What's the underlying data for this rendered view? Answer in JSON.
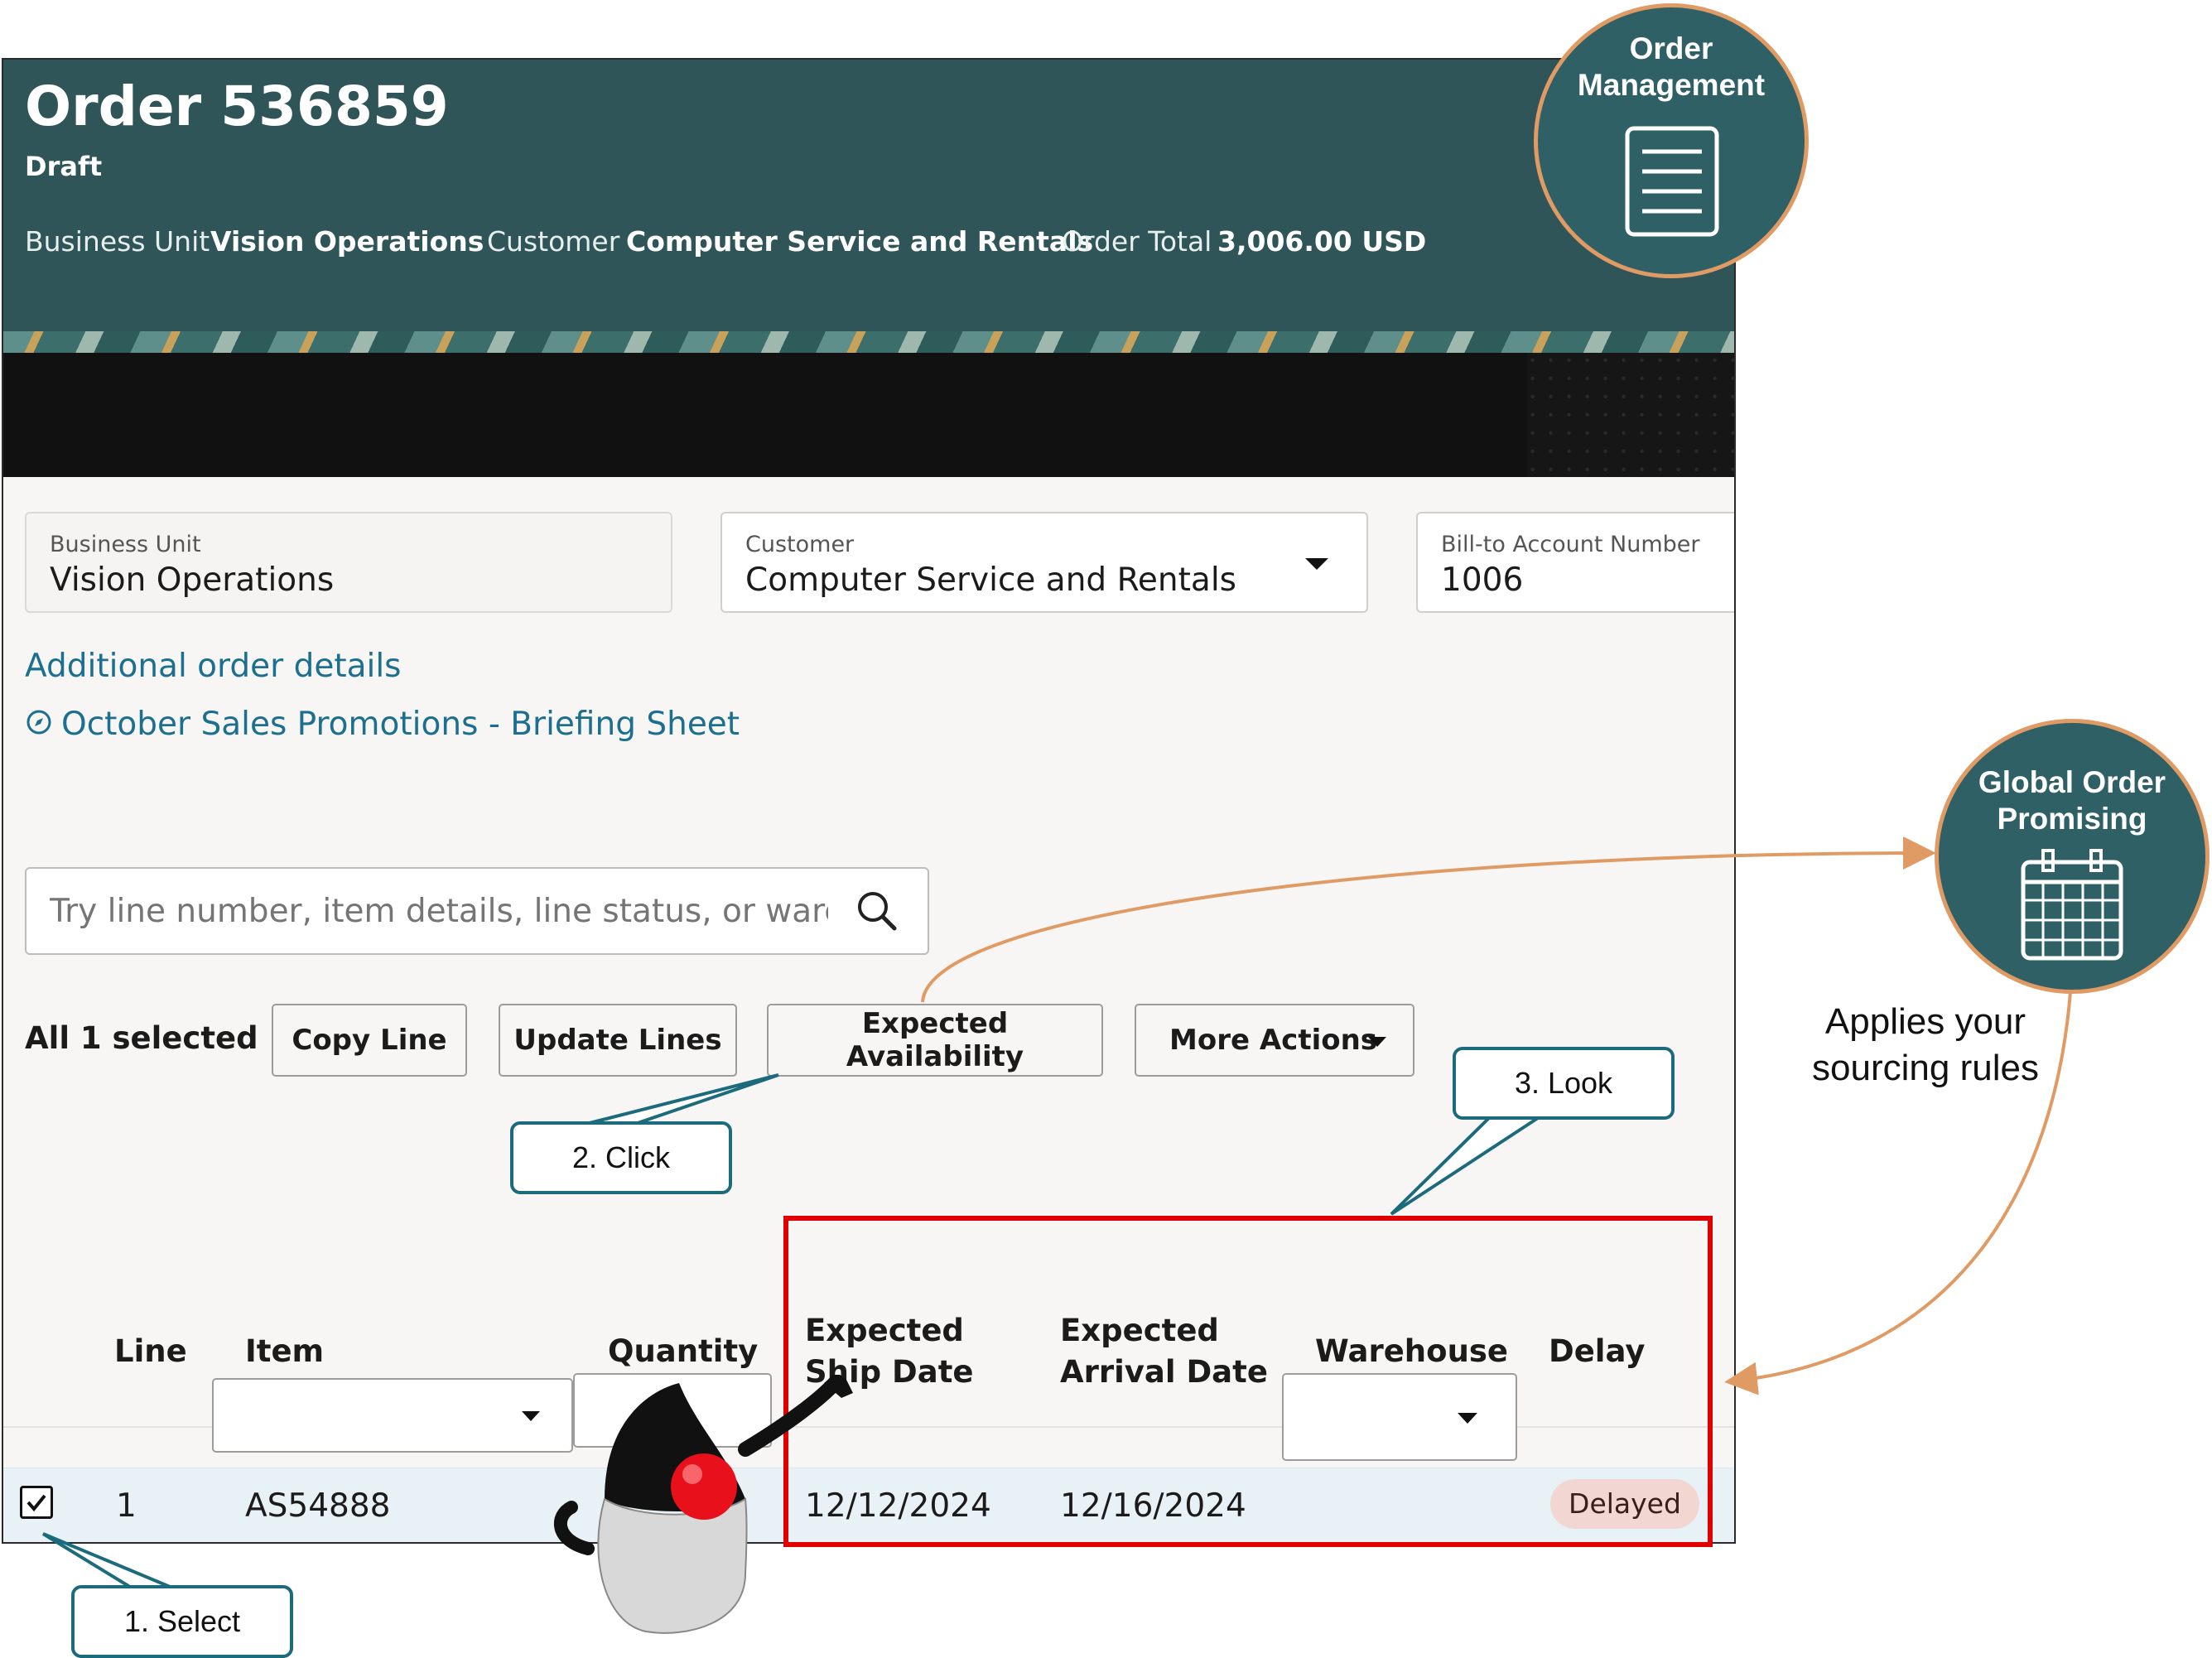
{
  "header": {
    "title": "Order 536859",
    "status": "Draft",
    "business_unit_label": "Business Unit",
    "business_unit_value": "Vision Operations",
    "customer_label": "Customer",
    "customer_value": "Computer Service and Rentals",
    "order_total_label": "Order Total",
    "order_total_value": "3,006.00 USD"
  },
  "fields": {
    "business_unit": {
      "label": "Business Unit",
      "value": "Vision Operations"
    },
    "customer": {
      "label": "Customer",
      "value": "Computer Service and Rentals"
    },
    "bill_to": {
      "label": "Bill-to Account Number",
      "value": "1006"
    }
  },
  "links": {
    "additional": "Additional order details",
    "promo": "October Sales Promotions - Briefing Sheet"
  },
  "search": {
    "placeholder": "Try line number, item details, line status, or warehouse"
  },
  "toolbar": {
    "selected": "All 1 selected",
    "copy_line": "Copy Line",
    "update_lines": "Update Lines",
    "expected_availability": "Expected Availability",
    "more_actions": "More Actions"
  },
  "table": {
    "columns": {
      "line": "Line",
      "item": "Item",
      "quantity": "Quantity",
      "ship_1": "Expected",
      "ship_2": "Ship Date",
      "arrival_1": "Expected",
      "arrival_2": "Arrival Date",
      "warehouse": "Warehouse",
      "delay": "Delay"
    },
    "rows": [
      {
        "line": "1",
        "item": "AS54888",
        "ship_date": "12/12/2024",
        "arrival_date": "12/16/2024",
        "delay": "Delayed"
      }
    ]
  },
  "annotations": {
    "order_management": [
      "Order",
      "Management"
    ],
    "gop": [
      "Global Order",
      "Promising"
    ],
    "note": [
      "Applies your",
      "sourcing rules"
    ],
    "step1": "1. Select",
    "step2": "2. Click",
    "step3": "3. Look"
  },
  "colors": {
    "header_bg": "#2f5558",
    "link": "#1d6f8f",
    "highlight_box": "#e00000",
    "callout_border": "#1c6b7d",
    "arrow": "#e09a64"
  }
}
